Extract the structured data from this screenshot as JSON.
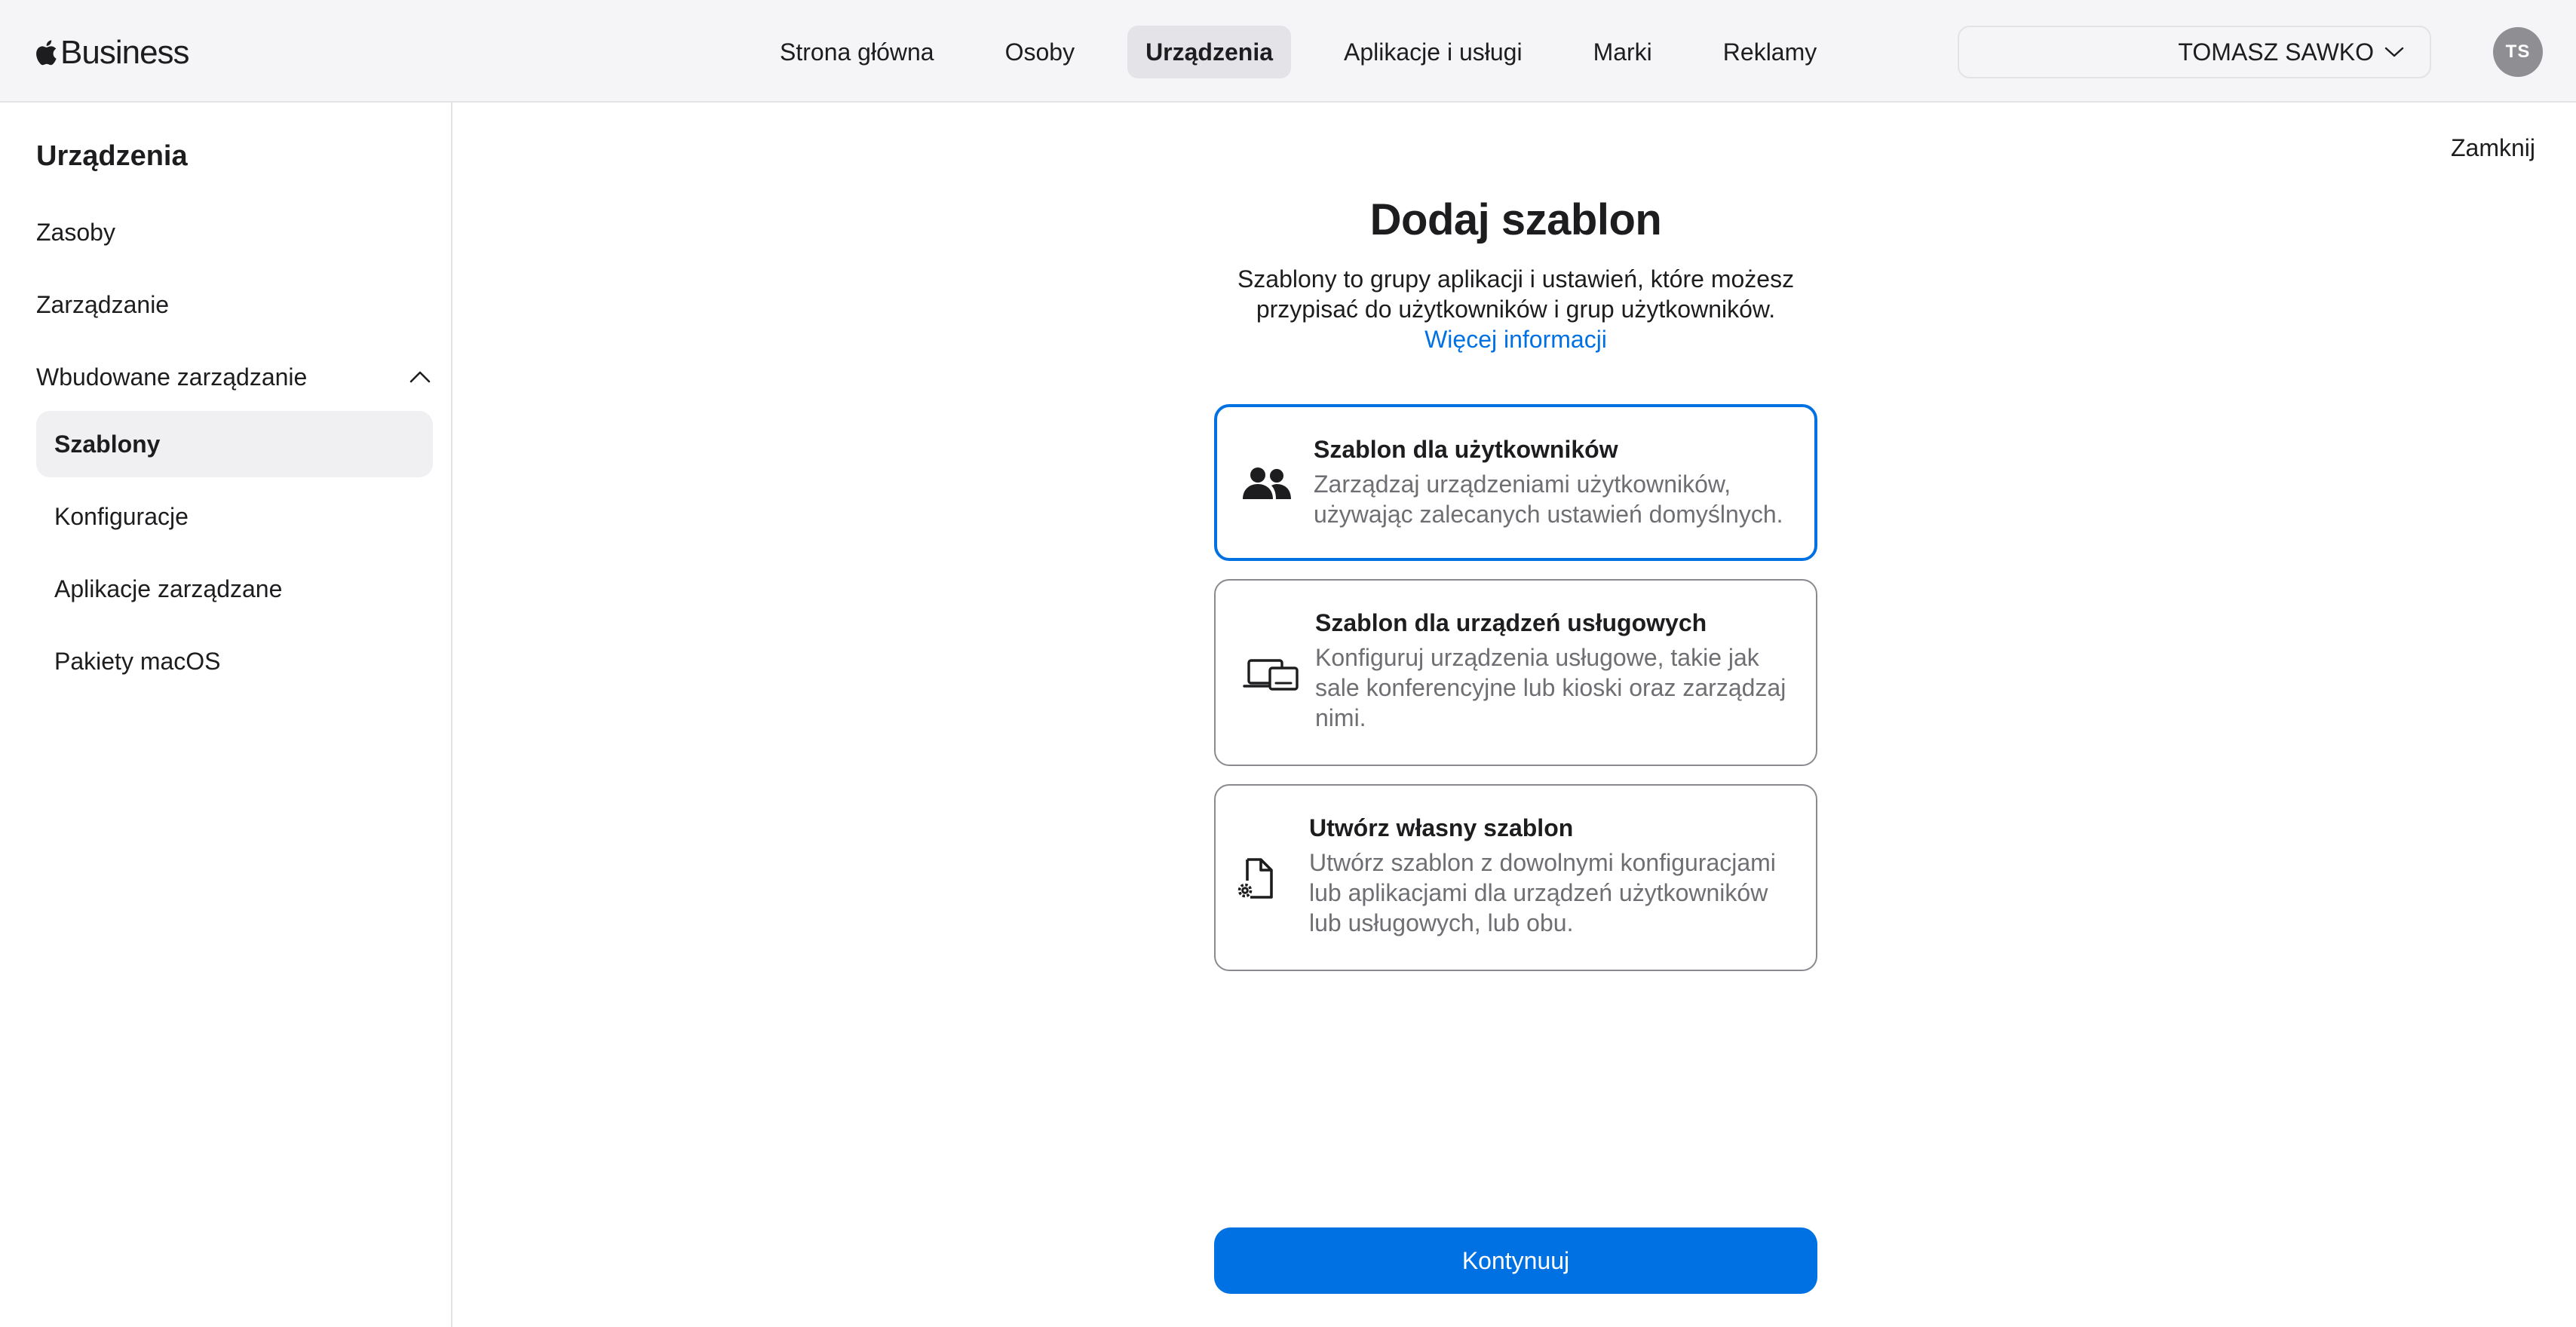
{
  "brand": {
    "name": "Business",
    "logo_icon": "apple-logo-icon"
  },
  "nav": {
    "items": [
      {
        "label": "Strona główna",
        "active": false
      },
      {
        "label": "Osoby",
        "active": false
      },
      {
        "label": "Urządzenia",
        "active": true
      },
      {
        "label": "Aplikacje i usługi",
        "active": false
      },
      {
        "label": "Marki",
        "active": false
      },
      {
        "label": "Reklamy",
        "active": false
      }
    ]
  },
  "account": {
    "name": "TOMASZ SAWKO",
    "icon": "chevron-down-icon",
    "avatar_initials": "TS"
  },
  "sidebar": {
    "title": "Urządzenia",
    "items": [
      {
        "label": "Zasoby"
      },
      {
        "label": "Zarządzanie"
      },
      {
        "label": "Wbudowane zarządzanie",
        "expanded": true,
        "icon": "chevron-up-icon"
      }
    ],
    "subitems": [
      {
        "label": "Szablony",
        "selected": true
      },
      {
        "label": "Konfiguracje",
        "selected": false
      },
      {
        "label": "Aplikacje zarządzane",
        "selected": false
      },
      {
        "label": "Pakiety macOS",
        "selected": false
      }
    ]
  },
  "main": {
    "close_label": "Zamknij",
    "title": "Dodaj szablon",
    "description": "Szablony to grupy aplikacji i ustawień, które możesz przypisać do użytkowników i grup użytkowników.",
    "more_link": "Więcej informacji",
    "options": [
      {
        "title": "Szablon dla użytkowników",
        "description": "Zarządzaj urządzeniami użytkowników, używając zalecanych ustawień domyślnych.",
        "icon": "people-icon",
        "selected": true
      },
      {
        "title": "Szablon dla urządzeń usługowych",
        "description": "Konfiguruj urządzenia usługowe, takie jak sale konferencyjne lub kioski oraz zarządzaj nimi.",
        "icon": "devices-icon",
        "selected": false
      },
      {
        "title": "Utwórz własny szablon",
        "description": "Utwórz szablon z dowolnymi konfiguracjami lub aplikacjami dla urządzeń użytkowników lub usługowych, lub obu.",
        "icon": "document-gear-icon",
        "selected": false
      }
    ],
    "continue_label": "Kontynuuj"
  },
  "colors": {
    "accent": "#0071e3",
    "header_bg": "#f5f5f7",
    "text": "#1d1d1f",
    "secondary_text": "#6e6e73"
  }
}
